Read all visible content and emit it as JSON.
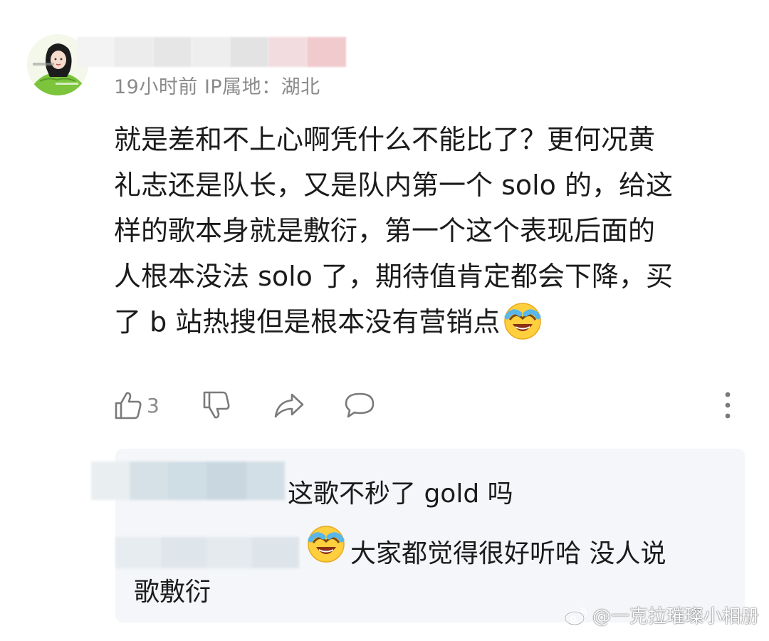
{
  "comment": {
    "meta": "19小时前  IP属地：湖北",
    "lines": [
      "就是差和不上心啊凭什么不能比了？更何况黄",
      "礼志还是队长，又是队内第一个 solo 的，给这",
      "样的歌本身就是敷衍，第一个这个表现后面的",
      "人根本没法 solo 了，期待值肯定都会下降，买",
      "了 b 站热搜但是根本没有营销点"
    ],
    "emoji": "laughing-crying-emoji"
  },
  "actions": {
    "like_count": "3",
    "icons": [
      "thumbs-up-icon",
      "thumbs-down-icon",
      "share-icon",
      "comment-icon",
      "more-icon"
    ]
  },
  "replies": [
    {
      "text": "这歌不秒了 gold 吗"
    },
    {
      "text": "大家都觉得很好听哈 没人说",
      "text2": "歌敷衍",
      "emoji": "laughing-crying-emoji"
    }
  ],
  "watermark": {
    "text": "@一克拉璀璨小相册",
    "icon": "weibo-icon"
  },
  "colors": {
    "text": "#1b1b1b",
    "meta": "#8a8a8a",
    "icon": "#7a7a7a",
    "reply_bg": "#f4f6f9"
  }
}
